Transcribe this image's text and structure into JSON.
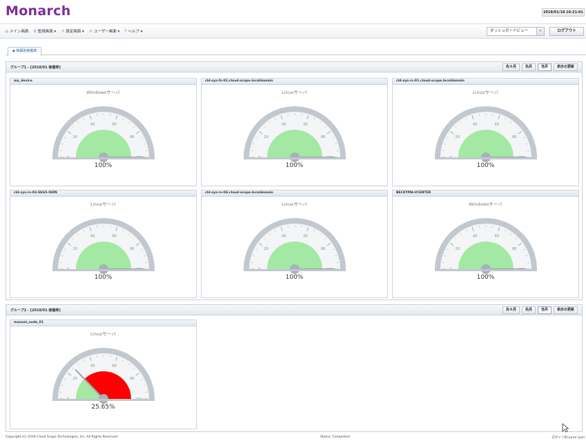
{
  "app": {
    "title": "Monarch",
    "datetime": "2018/01/18 16:21:01"
  },
  "menu": {
    "items": [
      {
        "label": "メイン画面",
        "icon": "home-icon"
      },
      {
        "label": "監視画面 ▾",
        "icon": "search-icon"
      },
      {
        "label": "設定画面 ▾",
        "icon": "wrench-icon"
      },
      {
        "label": "ユーザー画面 ▾",
        "icon": "wrench-icon"
      },
      {
        "label": "ヘルプ ▾",
        "icon": "help-icon"
      }
    ],
    "view_select": "ダッシュボードビュー",
    "logout": "ログアウト"
  },
  "tab": {
    "label": "稼図別稼働率"
  },
  "buttons": {
    "prev2": "先々月",
    "prev": "先月",
    "current": "当月",
    "refresh": "表示の更新"
  },
  "groups": [
    {
      "title": "グループ1 - [2018/01 稼働率]",
      "panels": [
        {
          "name": "my_device",
          "os": "Windowsサーバ",
          "value_text": "100%",
          "value": 100
        },
        {
          "name": "cld-sys-fs-02.cloud-scope.localdomain",
          "os": "Linuxサーバ",
          "value_text": "100%",
          "value": 100
        },
        {
          "name": "cld-sys-rs-01.cloud-scope.localdomain",
          "os": "Linuxサーバ",
          "value_text": "100%",
          "value": 100
        },
        {
          "name": "cld-sys-rs-03.SSG5-ISDN",
          "os": "Linuxサーバ",
          "value_text": "100%",
          "value": 100
        },
        {
          "name": "cld-sys-rs-04.cloud-scope.localdomain",
          "os": "Linuxサーバ",
          "value_text": "100%",
          "value": 100
        },
        {
          "name": "BECKYMA-VCENTER",
          "os": "Windowsサーバ",
          "value_text": "100%",
          "value": 100
        }
      ]
    },
    {
      "title": "グループ2 - [2018/01 稼働率]",
      "panels": [
        {
          "name": "manual_node_01",
          "os": "Linuxサーバ",
          "value_text": "25.65%",
          "value": 25.65
        }
      ]
    }
  ],
  "gauge": {
    "ticks": [
      "0",
      "20",
      "40",
      "60",
      "80",
      "100"
    ],
    "colors": {
      "ok": "#a3e8a3",
      "bad": "#ff0000",
      "frame": "#c2c8cf",
      "face": "#f4f5f6"
    }
  },
  "footer": {
    "copyright": "Copyright (C) 2018 Cloud Scope Technologies, Inc. All Rights Reserved.",
    "status": "Status: Completed",
    "login": "ログインID:yano [yan"
  }
}
